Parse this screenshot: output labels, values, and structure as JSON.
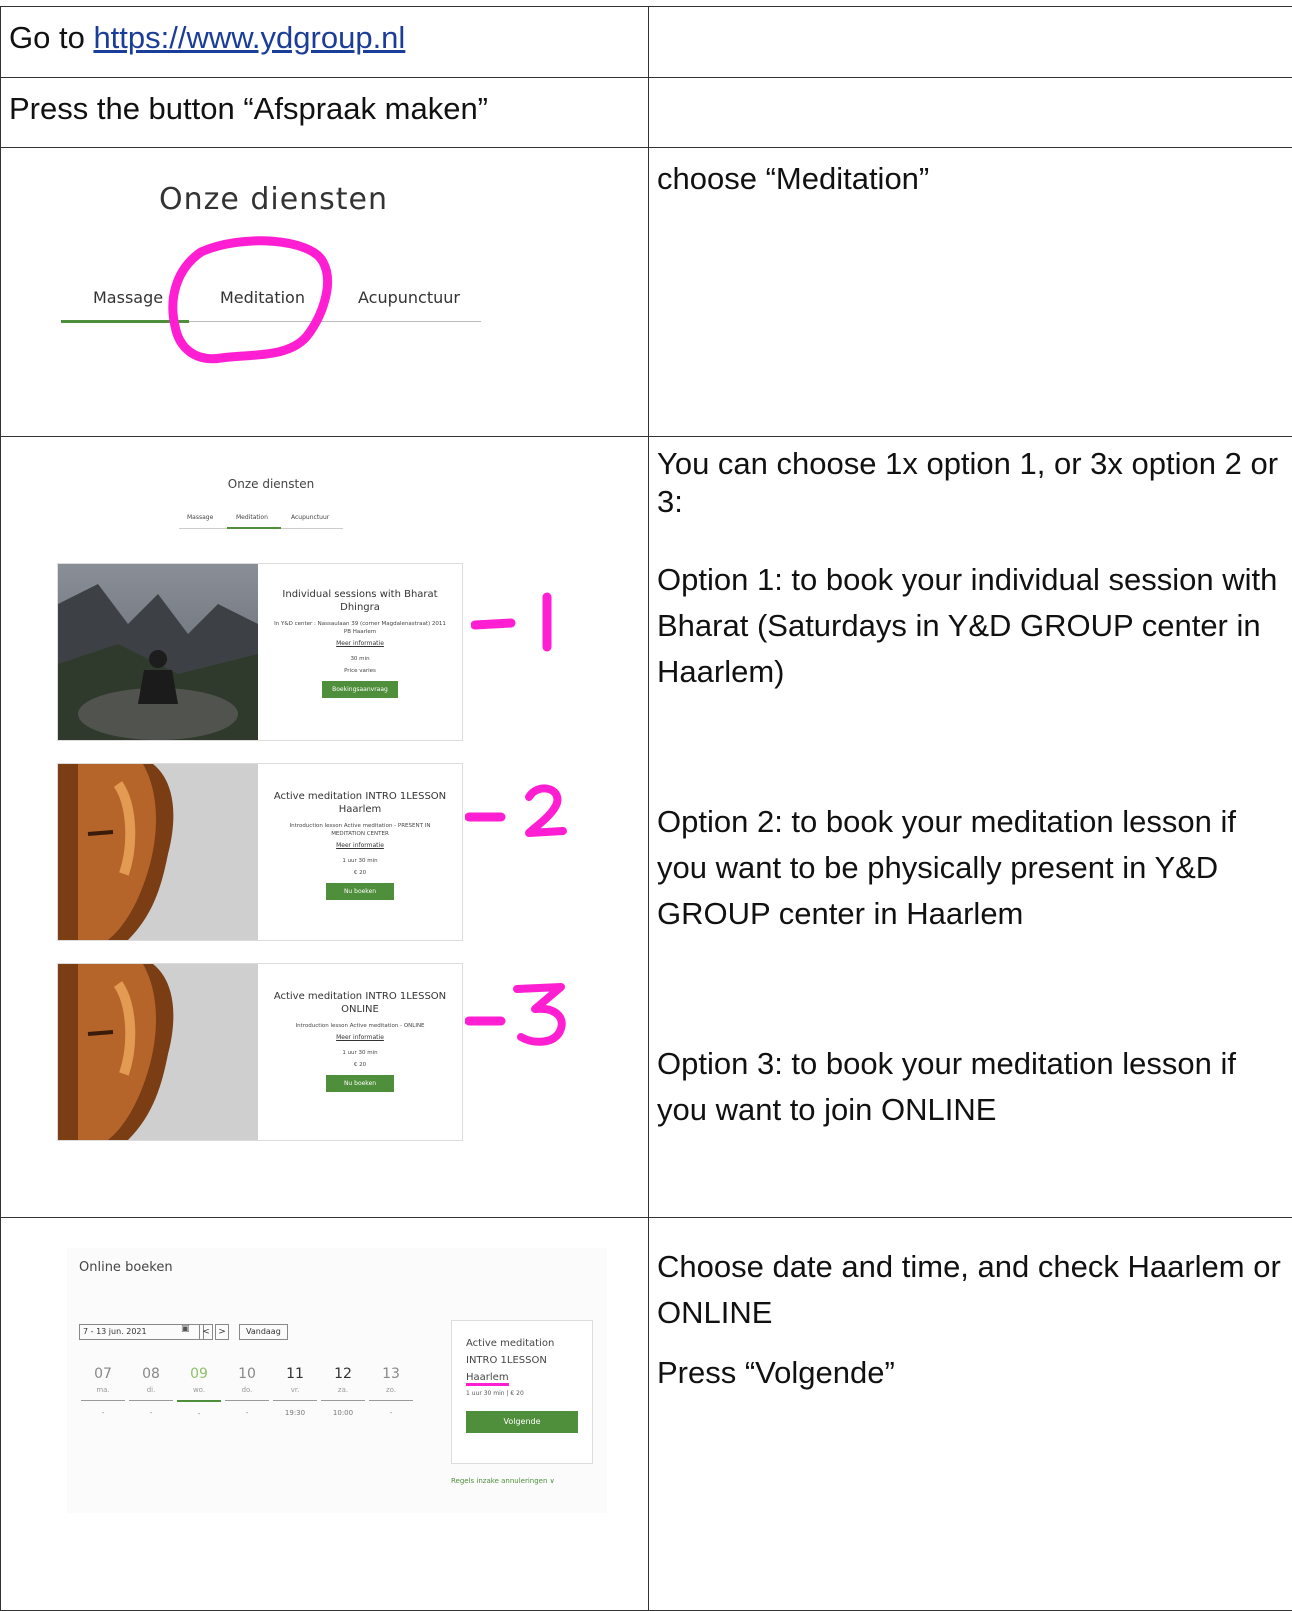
{
  "rows": [
    {
      "prefix": "Go to ",
      "link": "https://www.ydgroup.nl"
    },
    {
      "text": "Press the button “Afspraak maken”"
    }
  ],
  "step3": {
    "instruction": "choose “Meditation”",
    "shot": {
      "title": "Onze diensten",
      "tabs": [
        "Massage",
        "Meditation",
        "Acupunctuur"
      ]
    }
  },
  "step4": {
    "paragraphs": [
      "You can choose 1x option 1, or 3x option 2 or 3:",
      "Option 1: to book your individual session with Bharat (Saturdays in Y&D GROUP center in Haarlem)",
      "Option 2: to book your meditation lesson if you want to be physically present in Y&D GROUP center in Haarlem",
      "Option 3: to book your meditation lesson if you want to join ONLINE"
    ],
    "shot": {
      "title": "Onze diensten",
      "tabs": [
        "Massage",
        "Meditation",
        "Acupunctuur"
      ],
      "cards": [
        {
          "title": "Individual sessions with Bharat Dhingra",
          "detail": "In Y&D center : Nassaulaan 39 (corner Magdalenastraat) 2011 PB Haarlem",
          "link": "Meer informatie",
          "duration": "30 min",
          "price": "Price varies",
          "button": "Boekingsaanvraag",
          "annotation": "-1"
        },
        {
          "title": "Active meditation INTRO 1LESSON Haarlem",
          "detail": "Introduction lesson Active meditation - PRESENT IN MEDITATION CENTER",
          "link": "Meer informatie",
          "duration": "1 uur 30 min",
          "price": "€ 20",
          "button": "Nu boeken",
          "annotation": "-2"
        },
        {
          "title": "Active meditation INTRO 1LESSON ONLINE",
          "detail": "Introduction lesson Active meditation - ONLINE",
          "link": "Meer informatie",
          "duration": "1 uur 30 min",
          "price": "€ 20",
          "button": "Nu boeken",
          "annotation": "-3"
        }
      ]
    }
  },
  "step5": {
    "paragraphs": [
      "Choose date and time, and check Haarlem or ONLINE",
      "Press “Volgende”"
    ],
    "shot": {
      "title": "Online boeken",
      "range": "7 - 13 jun. 2021",
      "nav_prev": "<",
      "nav_next": ">",
      "today": "Vandaag",
      "days": [
        {
          "d": "07",
          "w": "ma.",
          "t": "-"
        },
        {
          "d": "08",
          "w": "di.",
          "t": "-"
        },
        {
          "d": "09",
          "w": "wo.",
          "t": "-"
        },
        {
          "d": "10",
          "w": "do.",
          "t": "-"
        },
        {
          "d": "11",
          "w": "vr.",
          "t": "19:30"
        },
        {
          "d": "12",
          "w": "za.",
          "t": "10:00"
        },
        {
          "d": "13",
          "w": "zo.",
          "t": "-"
        }
      ],
      "service_line1": "Active meditation",
      "service_line2": "INTRO 1LESSON",
      "service_line3": "Haarlem",
      "meta": "1 uur 30 min  |  € 20",
      "button": "Volgende",
      "rules": "Regels inzake annuleringen ∨"
    }
  },
  "colors": {
    "green": "#4f8e3a",
    "highlight": "#ff1ed1",
    "link": "#1a3d9a"
  }
}
